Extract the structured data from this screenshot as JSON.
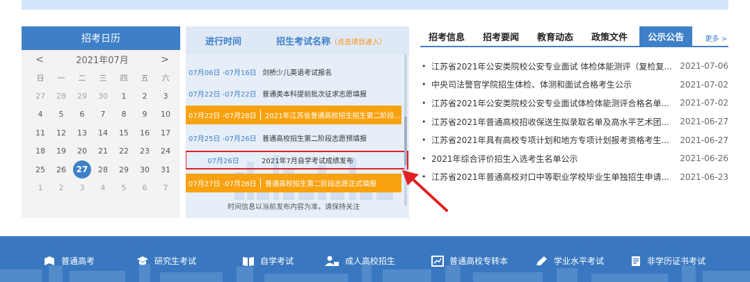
{
  "calendar": {
    "title": "招考日历",
    "month_label": "2021年07月",
    "prev_label": "<",
    "next_label": ">",
    "weekdays": [
      "日",
      "一",
      "二",
      "三",
      "四",
      "五",
      "六"
    ],
    "weeks": [
      [
        {
          "d": "27",
          "m": true
        },
        {
          "d": "28",
          "m": true
        },
        {
          "d": "29",
          "m": true
        },
        {
          "d": "30",
          "m": true
        },
        {
          "d": "1"
        },
        {
          "d": "2"
        },
        {
          "d": "3"
        }
      ],
      [
        {
          "d": "4"
        },
        {
          "d": "5"
        },
        {
          "d": "6"
        },
        {
          "d": "7"
        },
        {
          "d": "8"
        },
        {
          "d": "9"
        },
        {
          "d": "10"
        }
      ],
      [
        {
          "d": "11"
        },
        {
          "d": "12"
        },
        {
          "d": "13"
        },
        {
          "d": "14"
        },
        {
          "d": "15"
        },
        {
          "d": "16"
        },
        {
          "d": "17"
        }
      ],
      [
        {
          "d": "18"
        },
        {
          "d": "19"
        },
        {
          "d": "20"
        },
        {
          "d": "21"
        },
        {
          "d": "22"
        },
        {
          "d": "23"
        },
        {
          "d": "24"
        }
      ],
      [
        {
          "d": "25"
        },
        {
          "d": "26"
        },
        {
          "d": "27",
          "today": true
        },
        {
          "d": "28"
        },
        {
          "d": "29"
        },
        {
          "d": "30"
        },
        {
          "d": "31"
        }
      ],
      [
        {
          "d": "1",
          "m": true
        },
        {
          "d": "2",
          "m": true
        },
        {
          "d": "3",
          "m": true
        },
        {
          "d": "4",
          "m": true
        },
        {
          "d": "5",
          "m": true
        },
        {
          "d": "6",
          "m": true
        },
        {
          "d": "7",
          "m": true
        }
      ]
    ]
  },
  "schedule": {
    "col_time": "进行时间",
    "col_name": "招生考试名称",
    "col_name_hint": "（点击项目进入）",
    "rows": [
      {
        "date": "07月06日 -07月16日",
        "name": "剑桥少儿英语考试报名",
        "style": ""
      },
      {
        "date": "07月22日 -07月22日",
        "name": "普通类本科提前批次征求志愿填报",
        "style": ""
      },
      {
        "date": "07月22日 -07月28日",
        "name": "2021年江苏省普通高校招生招生第二阶段...",
        "style": "hl"
      },
      {
        "date": "07月25日 -07月26日",
        "name": "普通高校招生第二阶段志愿预填报",
        "style": ""
      },
      {
        "date": "07月26日",
        "name": "2021年7月自学考试成绩发布",
        "style": "boxed"
      },
      {
        "date": "07月27日 -07月28日",
        "name": "普通高校招生第二阶段志愿正式填报",
        "style": "hl"
      }
    ],
    "footer": "时间信息以当前发布内容为准，请保持关注"
  },
  "news": {
    "tabs": [
      "招考信息",
      "招考要闻",
      "教育动态",
      "政策文件"
    ],
    "active_tab": "公示公告",
    "more": "更多 >",
    "items": [
      {
        "title": "江苏省2021年公安类院校公安专业面试 体检体能测评（复检复...",
        "date": "2021-07-06"
      },
      {
        "title": "中央司法警官学院招生体检、体测和面试合格考生公示",
        "date": "2021-07-02"
      },
      {
        "title": "江苏省2021年公安类院校公安专业面试体检体能测评合格名单...",
        "date": "2021-07-02"
      },
      {
        "title": "江苏省2021年普通高校招收保送生拟录取名单及高水平艺术团...",
        "date": "2021-06-27"
      },
      {
        "title": "江苏省2021年具有高校专项计划和地方专项计划报考资格考生...",
        "date": "2021-06-27"
      },
      {
        "title": "2021年综合评价招生入选考生名单公示",
        "date": "2021-06-26"
      },
      {
        "title": "江苏省2021年普通高校对口中等职业学校毕业生单独招生申请...",
        "date": "2021-06-23"
      }
    ]
  },
  "footer_nav": [
    {
      "label": "普通高考",
      "icon": "mortarboard-icon"
    },
    {
      "label": "研究生考试",
      "icon": "graduate-icon"
    },
    {
      "label": "自学考试",
      "icon": "book-icon"
    },
    {
      "label": "成人高校招生",
      "icon": "adult-learner-icon"
    },
    {
      "label": "普通高校专转本",
      "icon": "chart-board-icon"
    },
    {
      "label": "学业水平考试",
      "icon": "pencil-icon"
    },
    {
      "label": "非学历证书考试",
      "icon": "certificate-icon"
    }
  ],
  "colors": {
    "accent_blue": "#3e80c8",
    "highlight_orange": "#f8a211",
    "annotation_red": "#e02020"
  }
}
